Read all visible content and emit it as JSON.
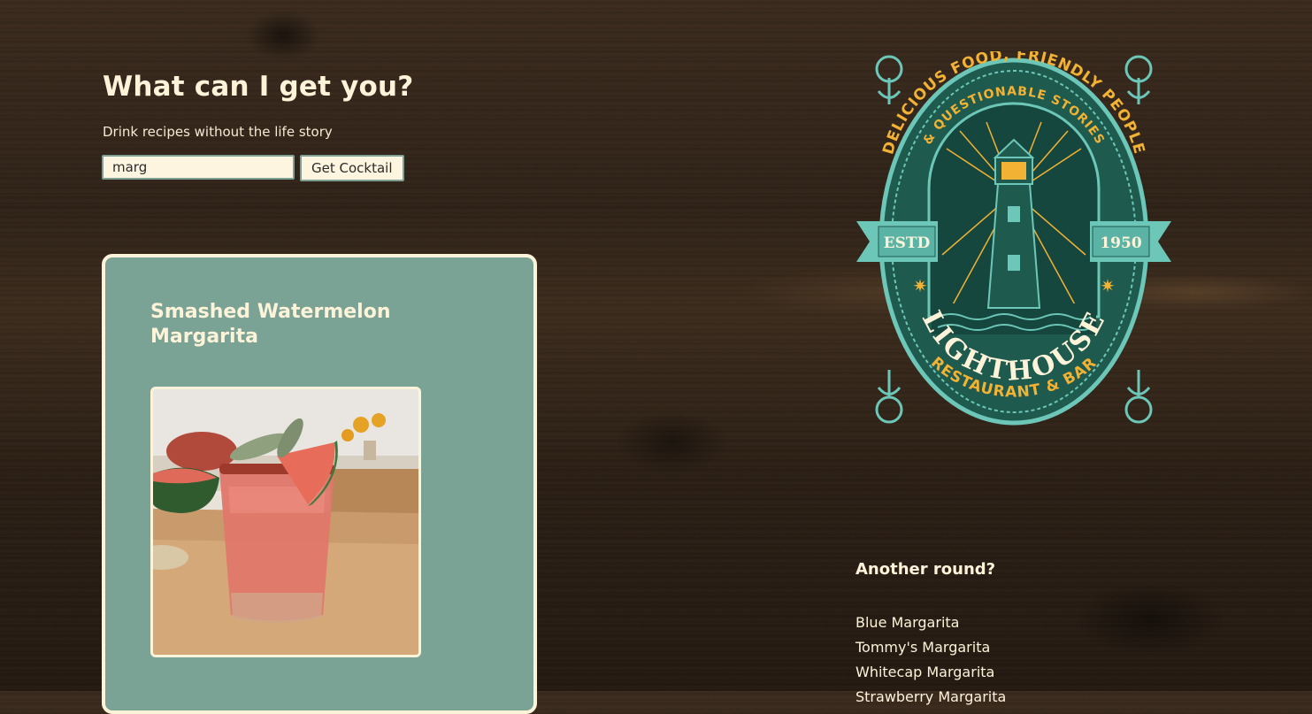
{
  "header": {
    "title": "What can I get you?",
    "subtitle": "Drink recipes without the life story"
  },
  "search": {
    "value": "marg",
    "button_label": "Get Cocktail"
  },
  "drink": {
    "name": "Smashed Watermelon Margarita",
    "image_icon": "margarita-photo"
  },
  "logo": {
    "arc_top": "DELICIOUS FOOD, FRIENDLY PEOPLE",
    "arc_inner": "& QUESTIONABLE STORIES",
    "estd_label": "ESTD",
    "year": "1950",
    "name": "LIGHTHOUSE",
    "tagline": "RESTAURANT & BAR"
  },
  "sidebar": {
    "heading": "Another round?",
    "items": [
      {
        "label": "Blue Margarita"
      },
      {
        "label": "Tommy's Margarita"
      },
      {
        "label": "Whitecap Margarita"
      },
      {
        "label": "Strawberry Margarita"
      }
    ]
  },
  "colors": {
    "cream": "#fdf3d9",
    "sage": "#7aa295",
    "teal_dark": "#1f5a4f",
    "teal_light": "#6cc7b8",
    "gold": "#f2b233",
    "wood": "#2f2217"
  }
}
